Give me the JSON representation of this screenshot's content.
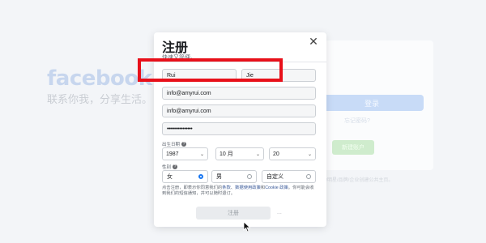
{
  "background": {
    "logo": "facebook",
    "tagline": "联系你我，分享生活。",
    "login_button": "登录",
    "forgot_link": "忘记密码?",
    "create_button": "新建账户",
    "create_page_text": "为明星/品牌/企业创建公共主页。"
  },
  "modal": {
    "title": "注册",
    "subtitle": "快速又简便。",
    "close_icon": "close-icon",
    "fields": {
      "first_name": "Rui",
      "last_name": "Jie",
      "email": "info@amyrui.com",
      "email_confirm": "info@amyrui.com",
      "password": "••••••••••••••••"
    },
    "birthday": {
      "label": "出生日期",
      "year": "1987",
      "month": "10 月",
      "day": "20"
    },
    "gender": {
      "label": "性别",
      "options": [
        "女",
        "男",
        "自定义"
      ],
      "selected": "女"
    },
    "terms": {
      "text_1": "点击注册，即表示你同意我们的",
      "link_terms": "条款",
      "text_2": "、",
      "link_data": "数据使用政策",
      "text_3": "和",
      "link_cookie": "Cookie 政策",
      "text_4": "。你可能会收到我们的短信通知，并可以随时退订。"
    },
    "signup_button": "注册",
    "ellipsis": "..."
  },
  "colors": {
    "annotation_red": "#e8101a",
    "facebook_blue": "#1877f2"
  }
}
